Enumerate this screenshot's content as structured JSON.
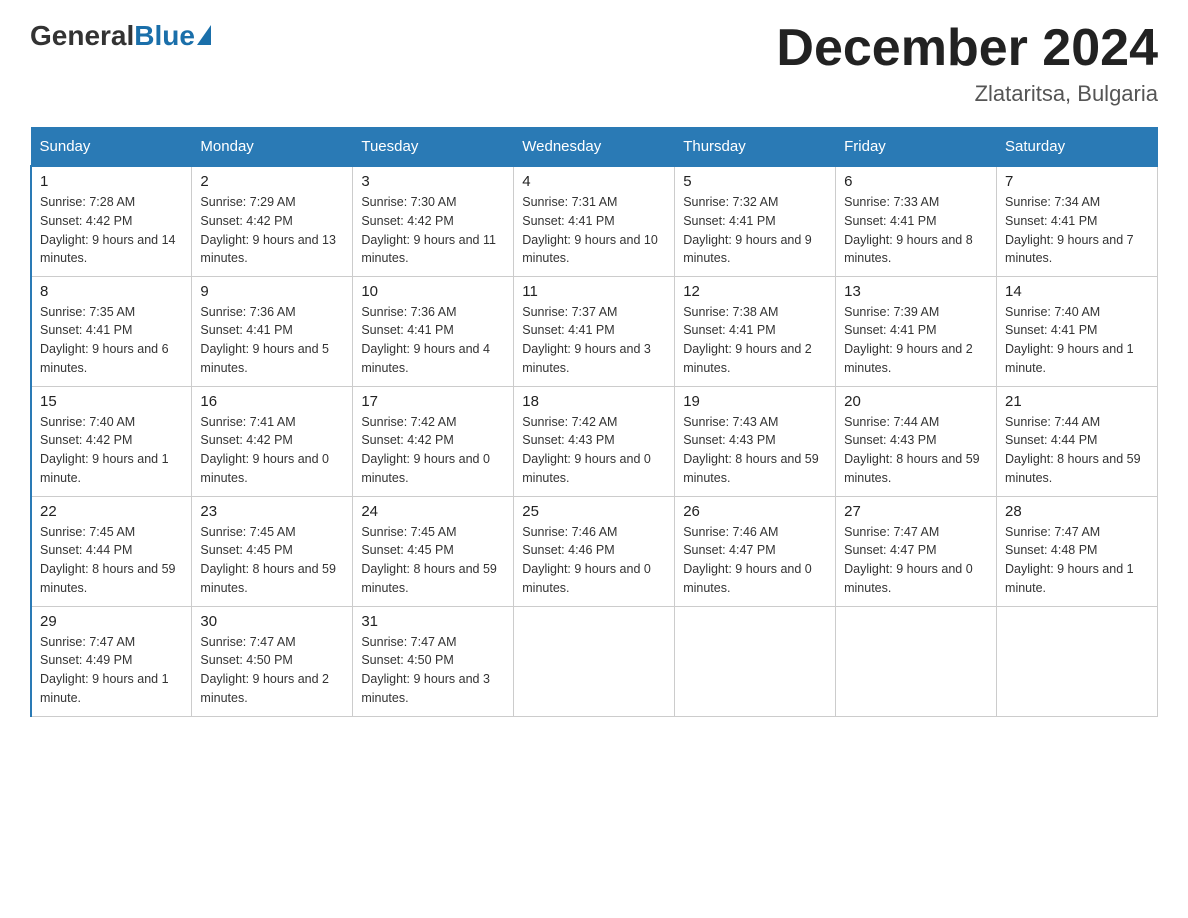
{
  "header": {
    "logo_general": "General",
    "logo_blue": "Blue",
    "month_title": "December 2024",
    "location": "Zlataritsa, Bulgaria"
  },
  "days_of_week": [
    "Sunday",
    "Monday",
    "Tuesday",
    "Wednesday",
    "Thursday",
    "Friday",
    "Saturday"
  ],
  "weeks": [
    [
      {
        "day": "1",
        "sunrise": "7:28 AM",
        "sunset": "4:42 PM",
        "daylight": "9 hours and 14 minutes."
      },
      {
        "day": "2",
        "sunrise": "7:29 AM",
        "sunset": "4:42 PM",
        "daylight": "9 hours and 13 minutes."
      },
      {
        "day": "3",
        "sunrise": "7:30 AM",
        "sunset": "4:42 PM",
        "daylight": "9 hours and 11 minutes."
      },
      {
        "day": "4",
        "sunrise": "7:31 AM",
        "sunset": "4:41 PM",
        "daylight": "9 hours and 10 minutes."
      },
      {
        "day": "5",
        "sunrise": "7:32 AM",
        "sunset": "4:41 PM",
        "daylight": "9 hours and 9 minutes."
      },
      {
        "day": "6",
        "sunrise": "7:33 AM",
        "sunset": "4:41 PM",
        "daylight": "9 hours and 8 minutes."
      },
      {
        "day": "7",
        "sunrise": "7:34 AM",
        "sunset": "4:41 PM",
        "daylight": "9 hours and 7 minutes."
      }
    ],
    [
      {
        "day": "8",
        "sunrise": "7:35 AM",
        "sunset": "4:41 PM",
        "daylight": "9 hours and 6 minutes."
      },
      {
        "day": "9",
        "sunrise": "7:36 AM",
        "sunset": "4:41 PM",
        "daylight": "9 hours and 5 minutes."
      },
      {
        "day": "10",
        "sunrise": "7:36 AM",
        "sunset": "4:41 PM",
        "daylight": "9 hours and 4 minutes."
      },
      {
        "day": "11",
        "sunrise": "7:37 AM",
        "sunset": "4:41 PM",
        "daylight": "9 hours and 3 minutes."
      },
      {
        "day": "12",
        "sunrise": "7:38 AM",
        "sunset": "4:41 PM",
        "daylight": "9 hours and 2 minutes."
      },
      {
        "day": "13",
        "sunrise": "7:39 AM",
        "sunset": "4:41 PM",
        "daylight": "9 hours and 2 minutes."
      },
      {
        "day": "14",
        "sunrise": "7:40 AM",
        "sunset": "4:41 PM",
        "daylight": "9 hours and 1 minute."
      }
    ],
    [
      {
        "day": "15",
        "sunrise": "7:40 AM",
        "sunset": "4:42 PM",
        "daylight": "9 hours and 1 minute."
      },
      {
        "day": "16",
        "sunrise": "7:41 AM",
        "sunset": "4:42 PM",
        "daylight": "9 hours and 0 minutes."
      },
      {
        "day": "17",
        "sunrise": "7:42 AM",
        "sunset": "4:42 PM",
        "daylight": "9 hours and 0 minutes."
      },
      {
        "day": "18",
        "sunrise": "7:42 AM",
        "sunset": "4:43 PM",
        "daylight": "9 hours and 0 minutes."
      },
      {
        "day": "19",
        "sunrise": "7:43 AM",
        "sunset": "4:43 PM",
        "daylight": "8 hours and 59 minutes."
      },
      {
        "day": "20",
        "sunrise": "7:44 AM",
        "sunset": "4:43 PM",
        "daylight": "8 hours and 59 minutes."
      },
      {
        "day": "21",
        "sunrise": "7:44 AM",
        "sunset": "4:44 PM",
        "daylight": "8 hours and 59 minutes."
      }
    ],
    [
      {
        "day": "22",
        "sunrise": "7:45 AM",
        "sunset": "4:44 PM",
        "daylight": "8 hours and 59 minutes."
      },
      {
        "day": "23",
        "sunrise": "7:45 AM",
        "sunset": "4:45 PM",
        "daylight": "8 hours and 59 minutes."
      },
      {
        "day": "24",
        "sunrise": "7:45 AM",
        "sunset": "4:45 PM",
        "daylight": "8 hours and 59 minutes."
      },
      {
        "day": "25",
        "sunrise": "7:46 AM",
        "sunset": "4:46 PM",
        "daylight": "9 hours and 0 minutes."
      },
      {
        "day": "26",
        "sunrise": "7:46 AM",
        "sunset": "4:47 PM",
        "daylight": "9 hours and 0 minutes."
      },
      {
        "day": "27",
        "sunrise": "7:47 AM",
        "sunset": "4:47 PM",
        "daylight": "9 hours and 0 minutes."
      },
      {
        "day": "28",
        "sunrise": "7:47 AM",
        "sunset": "4:48 PM",
        "daylight": "9 hours and 1 minute."
      }
    ],
    [
      {
        "day": "29",
        "sunrise": "7:47 AM",
        "sunset": "4:49 PM",
        "daylight": "9 hours and 1 minute."
      },
      {
        "day": "30",
        "sunrise": "7:47 AM",
        "sunset": "4:50 PM",
        "daylight": "9 hours and 2 minutes."
      },
      {
        "day": "31",
        "sunrise": "7:47 AM",
        "sunset": "4:50 PM",
        "daylight": "9 hours and 3 minutes."
      },
      null,
      null,
      null,
      null
    ]
  ]
}
